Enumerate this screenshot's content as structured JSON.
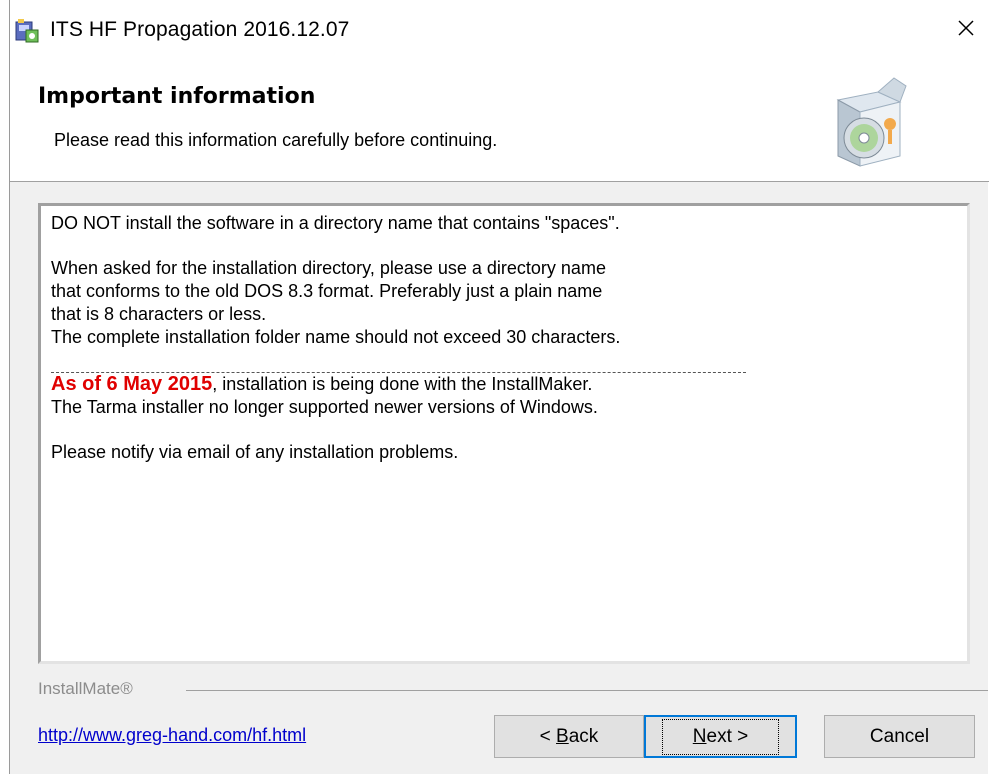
{
  "window": {
    "title": "ITS HF Propagation 2016.12.07",
    "close_glyph": "✕"
  },
  "header": {
    "title": "Important information",
    "subtitle": "Please read this information carefully before continuing."
  },
  "info": {
    "line1": "DO NOT install the software in a directory name that contains \"spaces\".",
    "line2": "When asked for the installation directory, please use a directory name",
    "line3": "that conforms to the old DOS 8.3 format. Preferably just a plain name",
    "line4": "that is 8 characters or less.",
    "line5": "The complete installation folder name should not exceed 30 characters.",
    "highlight": "As of 6 May 2015",
    "line6_rest": ", installation is being done with the InstallMaker.",
    "line7": "The Tarma installer no longer supported newer versions of Windows.",
    "line8": "Please notify via email of any installation problems."
  },
  "footer": {
    "brand": "InstallMate®",
    "link": "http://www.greg-hand.com/hf.html",
    "back_prefix": "< ",
    "back_accel": "B",
    "back_rest": "ack",
    "next_accel": "N",
    "next_rest": "ext >",
    "cancel": "Cancel"
  },
  "colors": {
    "highlight": "#e00000",
    "link": "#0000cc",
    "focus": "#0078d7"
  },
  "icons": {
    "app": "installer-app-icon",
    "header": "software-box-cd-icon",
    "close": "close-icon"
  }
}
